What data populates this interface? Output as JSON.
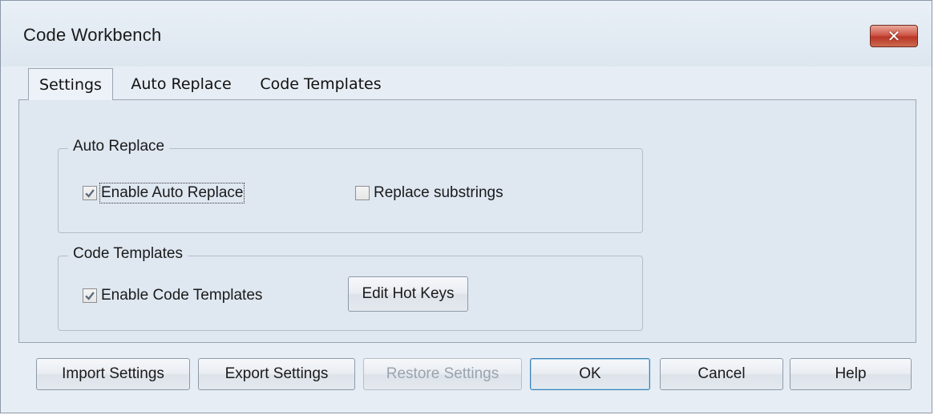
{
  "window": {
    "title": "Code Workbench",
    "close_glyph": "✕"
  },
  "tabs": [
    {
      "label": "Settings",
      "active": true
    },
    {
      "label": "Auto Replace",
      "active": false
    },
    {
      "label": "Code Templates",
      "active": false
    }
  ],
  "auto_replace_group": {
    "title": "Auto Replace",
    "enable_label": "Enable Auto Replace",
    "enable_checked": true,
    "substrings_label": "Replace substrings",
    "substrings_checked": false
  },
  "code_templates_group": {
    "title": "Code Templates",
    "enable_label": "Enable Code Templates",
    "enable_checked": true,
    "edit_hot_keys_label": "Edit Hot Keys"
  },
  "footer": {
    "import_label": "Import Settings",
    "export_label": "Export Settings",
    "restore_label": "Restore Settings",
    "restore_disabled": true,
    "ok_label": "OK",
    "cancel_label": "Cancel",
    "help_label": "Help"
  },
  "colors": {
    "window_bg": "#e7edf4",
    "panel_bg": "#dfe7f1",
    "close_button": "#c84a3a",
    "checkmark": "#5a6a7a"
  },
  "icons": {
    "close": "close-icon",
    "checkmark": "checkmark-icon"
  }
}
